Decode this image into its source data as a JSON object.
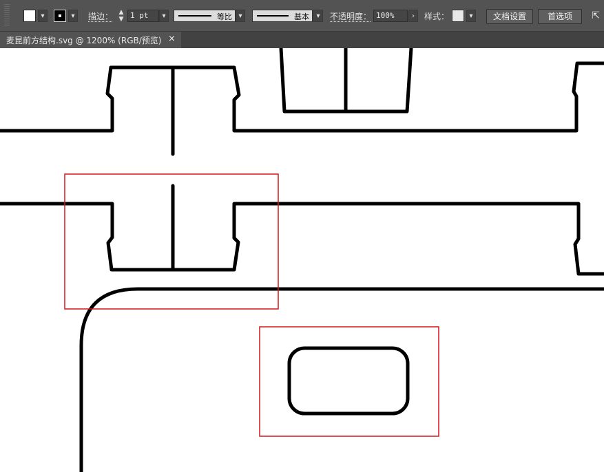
{
  "control_bar": {
    "fill_label": "fill-swatch",
    "stroke_label": "描边：",
    "stroke_weight": "1 pt",
    "profile_label": "等比",
    "brush_label": "基本",
    "opacity_label": "不透明度：",
    "opacity_value": "100%",
    "style_label": "样式：",
    "doc_setup_button": "文档设置",
    "preferences_button": "首选项"
  },
  "document_tab": {
    "title": "麦昆前方结构.svg @ 1200% (RGB/预览)",
    "close": "×"
  },
  "colors": {
    "panel": "#535353",
    "tabbar": "#424242",
    "canvas": "#ffffff",
    "artwork_stroke": "#000000",
    "selection_box": "#d4161c"
  },
  "icons": [
    "chevron-down-icon",
    "spinner-icon",
    "chevron-right-icon",
    "pin-icon",
    "close-icon"
  ]
}
